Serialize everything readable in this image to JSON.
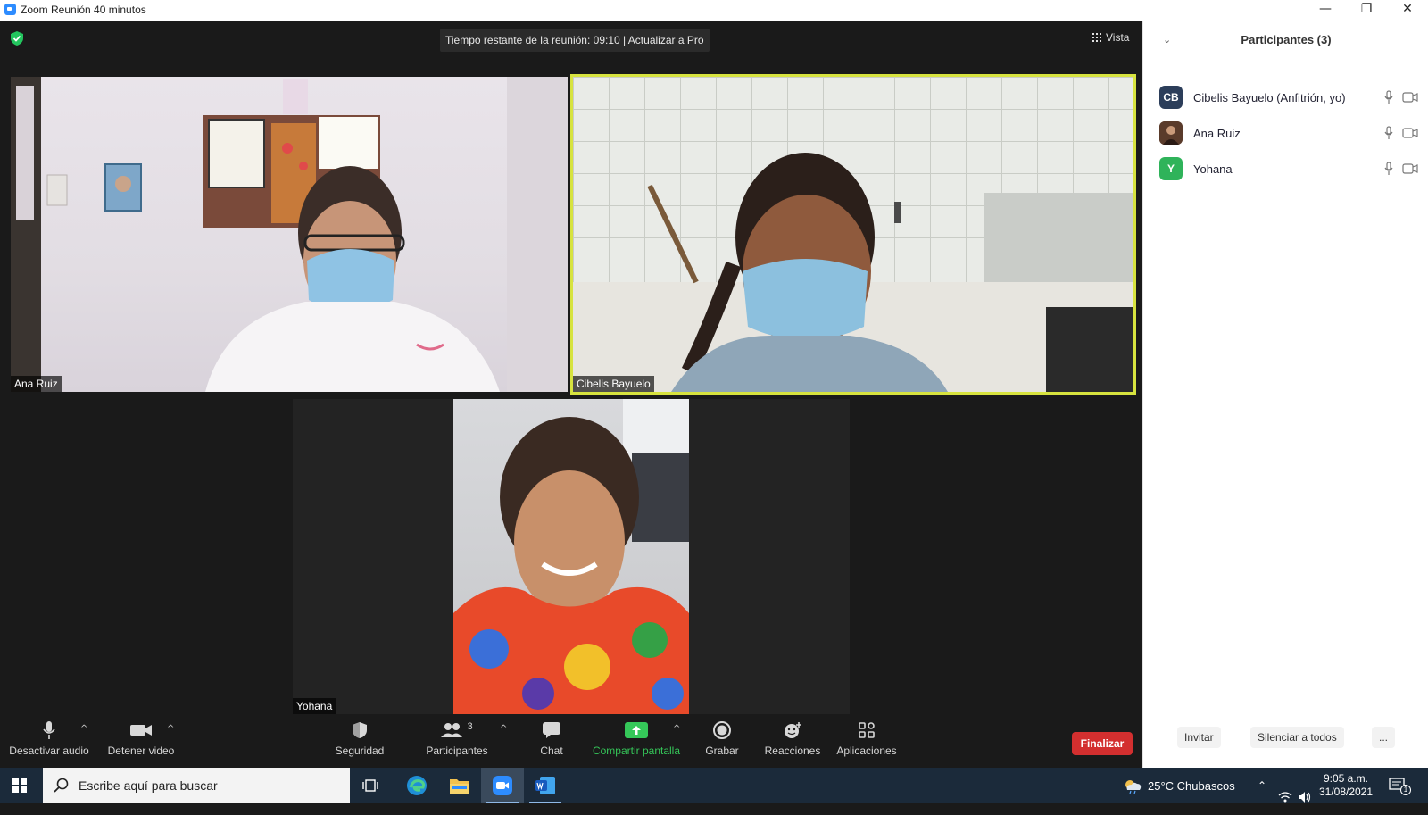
{
  "window": {
    "title": "Zoom Reunión 40 minutos",
    "minimize": "—",
    "restore": "❐",
    "close": "✕"
  },
  "meeting": {
    "timer_text": "Tiempo restante de la reunión: 09:10 | Actualizar a Pro",
    "view_label": "Vista",
    "tiles": [
      {
        "name": "Ana Ruiz"
      },
      {
        "name": "Cibelis Bayuelo",
        "active_speaker": true
      },
      {
        "name": "Yohana"
      }
    ],
    "active_border_color": "#d7e33f"
  },
  "toolbar": {
    "mute_label": "Desactivar audio",
    "video_label": "Detener video",
    "security_label": "Seguridad",
    "participants_label": "Participantes",
    "participants_count": "3",
    "chat_label": "Chat",
    "share_label": "Compartir pantalla",
    "record_label": "Grabar",
    "reactions_label": "Reacciones",
    "apps_label": "Aplicaciones",
    "end_label": "Finalizar",
    "caret": "^"
  },
  "panel": {
    "title": "Participantes (3)",
    "collapse_icon": "⌄",
    "participants": [
      {
        "initials": "CB",
        "name": "Cibelis Bayuelo (Anfitrión, yo)",
        "avatar_color": "#2c3e5a"
      },
      {
        "initials": "",
        "name": "Ana Ruiz",
        "avatar_color": "#5a3b2b"
      },
      {
        "initials": "Y",
        "name": "Yohana",
        "avatar_color": "#2fb35a"
      }
    ],
    "invite_label": "Invitar",
    "mute_all_label": "Silenciar a todos",
    "more_label": "..."
  },
  "taskbar": {
    "search_placeholder": "Escribe aquí para buscar",
    "weather": "25°C  Chubascos",
    "time": "9:05 a.m.",
    "date": "31/08/2021",
    "notification_count": "1"
  }
}
